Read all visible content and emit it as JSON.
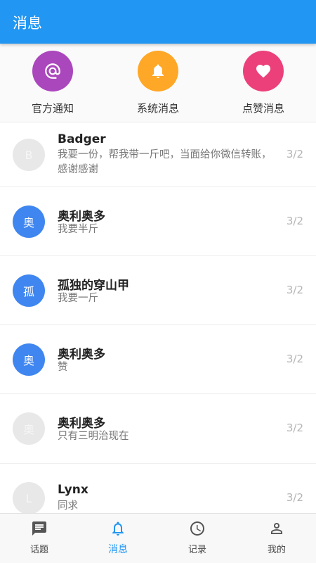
{
  "appbar": {
    "title": "消息"
  },
  "categories": [
    {
      "label": "官方通知",
      "icon": "at-icon",
      "color": "#ab47bc"
    },
    {
      "label": "系统消息",
      "icon": "bell-icon",
      "color": "#ffa726"
    },
    {
      "label": "点赞消息",
      "icon": "heart-icon",
      "color": "#ec407a"
    }
  ],
  "messages": [
    {
      "avatar": "B",
      "name": "Badger",
      "text": "我要一份，帮我带一斤吧，当面给你微信转账，感谢感谢",
      "date": "3/2"
    },
    {
      "avatar": "奥",
      "name": "奥利奥多",
      "text": "我要半斤",
      "date": "3/2"
    },
    {
      "avatar": "孤",
      "name": "孤独的穿山甲",
      "text": "我要一斤",
      "date": "3/2"
    },
    {
      "avatar": "奥",
      "name": "奥利奥多",
      "text": "赞",
      "date": "3/2"
    },
    {
      "avatar": "奥",
      "name": "奥利奥多",
      "text": "只有三明治现在",
      "date": "3/2"
    },
    {
      "avatar": "L",
      "name": "Lynx",
      "text": "同求",
      "date": "3/2"
    }
  ],
  "nav": [
    {
      "label": "话题",
      "icon": "chat-icon"
    },
    {
      "label": "消息",
      "icon": "bell-icon"
    },
    {
      "label": "记录",
      "icon": "clock-icon"
    },
    {
      "label": "我的",
      "icon": "person-icon"
    }
  ],
  "colors": {
    "primary": "#2196f3",
    "avatar_blue": "#3f86f0",
    "avatar_gray": "#e8e8e8"
  }
}
